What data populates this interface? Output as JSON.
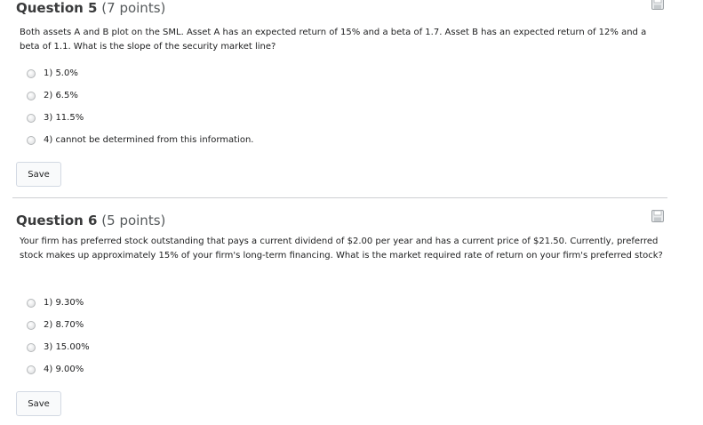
{
  "questions": [
    {
      "label": "Question 5",
      "points": "(7 points)",
      "text": "Both assets A and B plot on the SML. Asset A has an expected return of 15% and a beta of 1.7. Asset B has an expected return of 12% and a beta of 1.1. What is the slope of the security market line?",
      "options": [
        "1) 5.0%",
        "2) 6.5%",
        "3) 11.5%",
        "4) cannot be determined from this information."
      ],
      "save_label": "Save",
      "save_icon": "floppy-disk-icon"
    },
    {
      "label": "Question 6",
      "points": "(5 points)",
      "text": "Your firm has preferred stock outstanding that pays a current dividend of $2.00 per year and has a current price of $21.50. Currently, preferred stock makes up approximately 15% of your firm's long-term financing. What is the market required rate of return on your firm's preferred stock?",
      "options": [
        "1) 9.30%",
        "2) 8.70%",
        "3) 15.00%",
        "4) 9.00%"
      ],
      "save_label": "Save",
      "save_icon": "floppy-disk-icon"
    }
  ]
}
